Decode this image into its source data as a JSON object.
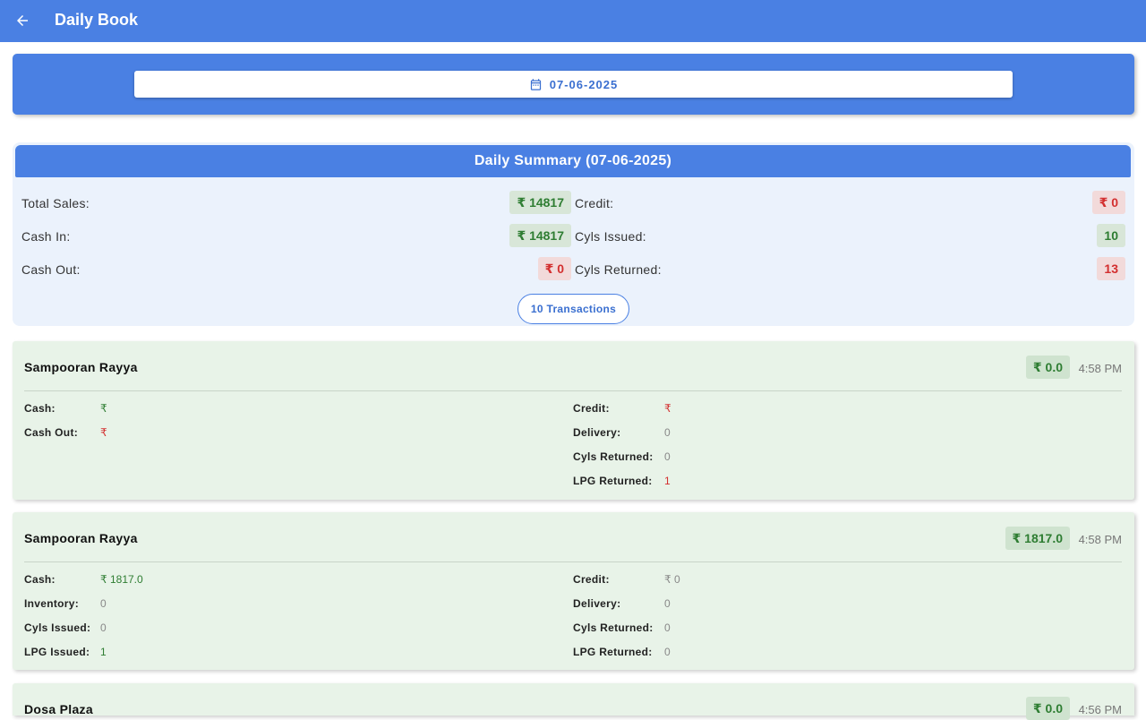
{
  "appbar": {
    "title": "Daily Book"
  },
  "date_picker": {
    "value": "07-06-2025"
  },
  "summary": {
    "title": "Daily Summary (07-06-2025)",
    "total_sales_label": "Total Sales:",
    "total_sales_value": "₹ 14817",
    "cash_in_label": "Cash In:",
    "cash_in_value": "₹ 14817",
    "cash_out_label": "Cash Out:",
    "cash_out_value": "₹ 0",
    "credit_label": "Credit:",
    "credit_value": "₹ 0",
    "cyls_issued_label": "Cyls Issued:",
    "cyls_issued_value": "10",
    "cyls_returned_label": "Cyls Returned:",
    "cyls_returned_value": "13",
    "transactions_button": "10 Transactions"
  },
  "transactions": [
    {
      "name": "Sampooran Rayya",
      "amount": "₹ 0.0",
      "time": "4:58 PM",
      "left": [
        {
          "label": "Cash:",
          "value": "₹"
        },
        {
          "label": "Cash Out:",
          "value": "₹"
        }
      ],
      "right": [
        {
          "label": "Credit:",
          "value": "₹"
        },
        {
          "label": "Delivery:",
          "value": "0"
        },
        {
          "label": "Cyls Returned:",
          "value": "0"
        },
        {
          "label": "LPG Returned:",
          "value": "1"
        }
      ]
    },
    {
      "name": "Sampooran Rayya",
      "amount": "₹ 1817.0",
      "time": "4:58 PM",
      "left": [
        {
          "label": "Cash:",
          "value": "₹ 1817.0"
        },
        {
          "label": "Inventory:",
          "value": "0"
        },
        {
          "label": "Cyls Issued:",
          "value": "0"
        },
        {
          "label": "LPG Issued:",
          "value": "1"
        }
      ],
      "right": [
        {
          "label": "Credit:",
          "value": "₹ 0"
        },
        {
          "label": "Delivery:",
          "value": "0"
        },
        {
          "label": "Cyls Returned:",
          "value": "0"
        },
        {
          "label": "LPG Returned:",
          "value": "0"
        }
      ]
    },
    {
      "name": "Dosa Plaza",
      "amount": "₹ 0.0",
      "time": "4:56 PM"
    }
  ],
  "colors": {
    "primary": "#4a80e3",
    "green": "#2e7d32",
    "red": "#d32f2f",
    "card_bg": "#e8f3e8",
    "summary_bg": "#ebf2fc"
  },
  "icons": {
    "back": "arrow-left-icon",
    "calendar": "calendar-icon"
  }
}
